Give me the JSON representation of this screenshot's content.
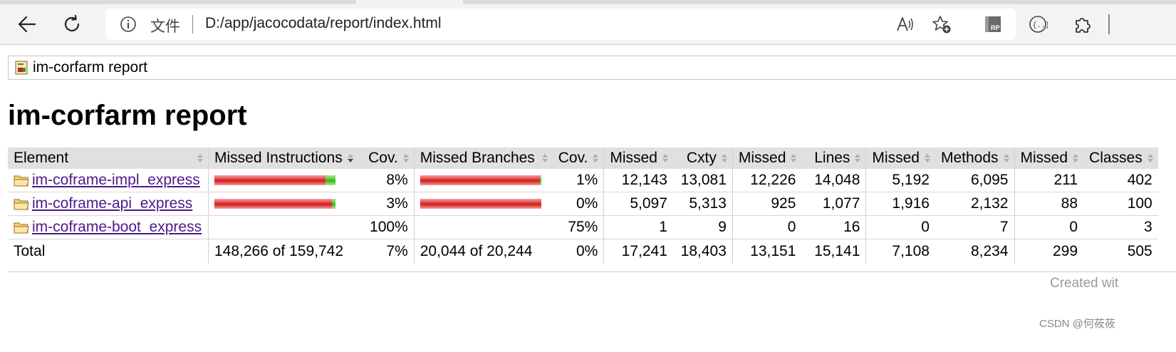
{
  "browser": {
    "address_protocol": "文件",
    "address_url": "D:/app/jacocodata/report/index.html"
  },
  "page": {
    "breadcrumb": "im-corfarm report",
    "title": "im-corfarm report",
    "footer_text": "Created wit",
    "watermark": "CSDN @何莜莜"
  },
  "table": {
    "headers": [
      "Element",
      "Missed Instructions",
      "Cov.",
      "Missed Branches",
      "Cov.",
      "Missed",
      "Cxty",
      "Missed",
      "Lines",
      "Missed",
      "Methods",
      "Missed",
      "Classes"
    ],
    "rows": [
      {
        "name": "im-coframe-impl_express",
        "instr_bar": {
          "missed_fraction": 0.917,
          "covered_fraction": 0.083
        },
        "instr_cov": "8%",
        "branch_bar": {
          "missed_fraction": 0.99,
          "covered_fraction": 0.01
        },
        "branch_cov": "1%",
        "cxty_missed": "12,143",
        "cxty": "13,081",
        "lines_missed": "12,226",
        "lines": "14,048",
        "methods_missed": "5,192",
        "methods": "6,095",
        "classes_missed": "211",
        "classes": "402"
      },
      {
        "name": "im-coframe-api_express",
        "instr_bar": {
          "missed_fraction": 0.97,
          "covered_fraction": 0.03
        },
        "instr_cov": "3%",
        "branch_bar": {
          "missed_fraction": 1.0,
          "covered_fraction": 0.0
        },
        "branch_cov": "0%",
        "cxty_missed": "5,097",
        "cxty": "5,313",
        "lines_missed": "925",
        "lines": "1,077",
        "methods_missed": "1,916",
        "methods": "2,132",
        "classes_missed": "88",
        "classes": "100"
      },
      {
        "name": "im-coframe-boot_express",
        "instr_bar": null,
        "instr_cov": "100%",
        "branch_bar": null,
        "branch_cov": "75%",
        "cxty_missed": "1",
        "cxty": "9",
        "lines_missed": "0",
        "lines": "16",
        "methods_missed": "0",
        "methods": "7",
        "classes_missed": "0",
        "classes": "3"
      }
    ],
    "total": {
      "label": "Total",
      "instr": "148,266 of 159,742",
      "instr_cov": "7%",
      "branch": "20,044 of 20,244",
      "branch_cov": "0%",
      "cxty_missed": "17,241",
      "cxty": "18,403",
      "lines_missed": "13,151",
      "lines": "15,141",
      "methods_missed": "7,108",
      "methods": "8,234",
      "classes_missed": "299",
      "classes": "505"
    }
  },
  "colors": {
    "bar_missed": "#d71a1a",
    "bar_covered": "#3fb41f",
    "link": "#4b1a8a",
    "header_bg": "#e0e0e0"
  }
}
